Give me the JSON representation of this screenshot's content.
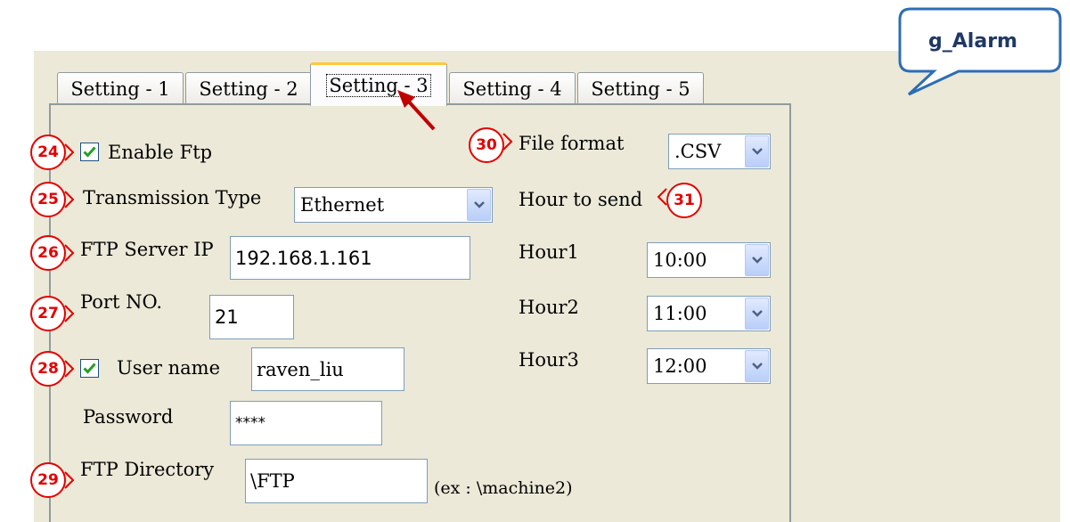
{
  "tabs": [
    "Setting - 1",
    "Setting - 2",
    "Setting - 3",
    "Setting - 4",
    "Setting - 5"
  ],
  "active_tab": "Setting - 3",
  "enable_ftp": {
    "label": "Enable Ftp",
    "checked": true
  },
  "transmission_type": {
    "label": "Transmission Type",
    "value": "Ethernet"
  },
  "ftp_server_ip": {
    "label": "FTP Server IP",
    "value": "192.168.1.161"
  },
  "port": {
    "label": "Port NO.",
    "value": "21"
  },
  "user_name": {
    "label": "User name",
    "value": "raven_liu",
    "checked": true
  },
  "password": {
    "label": "Password",
    "value": "****"
  },
  "ftp_directory": {
    "label": "FTP Directory",
    "value": "\\FTP",
    "hint": "(ex : \\machine2)"
  },
  "file_format": {
    "label": "File format",
    "value": ".CSV"
  },
  "hour_to_send": {
    "label": "Hour to send"
  },
  "hour1": {
    "label": "Hour1",
    "value": "10:00"
  },
  "hour2": {
    "label": "Hour2",
    "value": "11:00"
  },
  "hour3": {
    "label": "Hour3",
    "value": "12:00"
  },
  "callouts": {
    "c24": "24",
    "c25": "25",
    "c26": "26",
    "c27": "27",
    "c28": "28",
    "c29": "29",
    "c30": "30",
    "c31": "31"
  },
  "bubble": {
    "text": "g_Alarm"
  },
  "colors": {
    "callout": "#E30000",
    "bubble_border": "#2E6DB4",
    "bubble_text": "#1F3864",
    "arrow": "#C00000",
    "window_bg": "#ECE9D8",
    "tab_highlight": "#FFC83C"
  }
}
